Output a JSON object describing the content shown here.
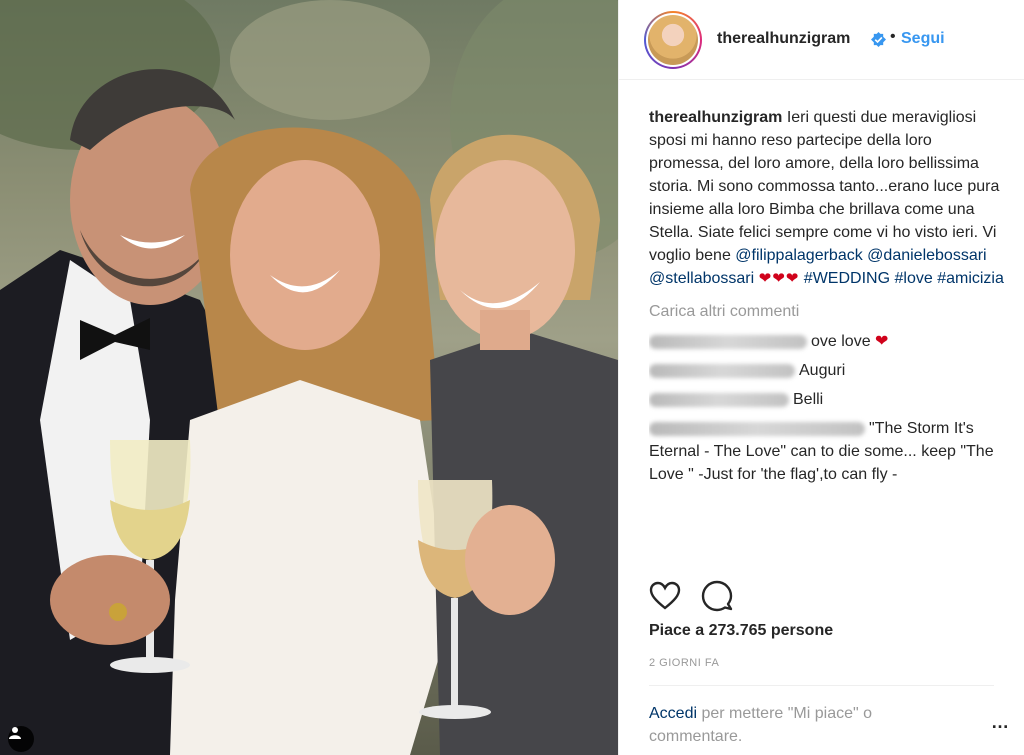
{
  "header": {
    "username": "therealhunzigram",
    "separator": "•",
    "follow_label": "Segui",
    "verified_icon": "verified-badge-icon",
    "accent_color": "#3897f0"
  },
  "caption": {
    "username": "therealhunzigram",
    "text": "Ieri questi due meravigliosi sposi mi hanno reso partecipe della loro promessa, del loro amore, della loro bellissima storia. Mi sono commossa tanto...erano luce pura insieme alla loro Bimba che brillava come una Stella. Siate felici sempre come vi ho visto ieri. Vi voglio bene",
    "mention_1": "@filippalagerback",
    "mention_2": "@danielebossari",
    "mention_3": "@stellabossari",
    "hearts": "❤❤❤",
    "hashtag_1": "#WEDDING",
    "hashtag_2": "#love",
    "hashtag_3": "#amicizia"
  },
  "load_more_label": "Carica altri commenti",
  "comments": [
    {
      "visible_text": "ove love"
    },
    {
      "visible_text": "Auguri"
    },
    {
      "visible_text": "Belli"
    },
    {
      "visible_text": "\"The Storm It's Eternal - The Love\" can to die some... keep \"The Love \" -Just for 'the flag',to can fly -"
    }
  ],
  "actions": {
    "like_icon": "heart-icon",
    "comment_icon": "comment-icon"
  },
  "likes_label": "Piace a 273.765 persone",
  "date_label": "2 GIORNI FA",
  "login": {
    "link_label": "Accedi",
    "rest": " per mettere \"Mi piace\" o commentare."
  },
  "more_label": "…",
  "photo": {
    "tag_icon": "user-tag-icon"
  }
}
